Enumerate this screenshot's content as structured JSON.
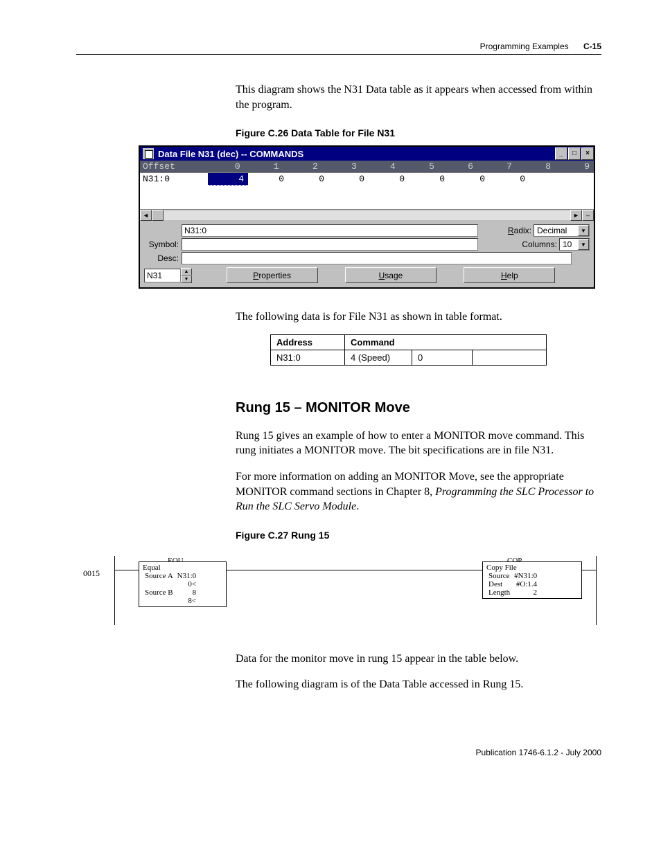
{
  "header": {
    "section": "Programming Examples",
    "pagenum": "C-15"
  },
  "intro": "This diagram shows the N31 Data table as it appears when accessed from within the program.",
  "fig26_caption": "Figure C.26 Data Table for File N31",
  "datafile": {
    "title": "Data File N31 (dec) -- COMMANDS",
    "header_cols": [
      "Offset",
      "0",
      "1",
      "2",
      "3",
      "4",
      "5",
      "6",
      "7",
      "8",
      "9"
    ],
    "row_label": "N31:0",
    "row_vals": [
      "4",
      "0",
      "0",
      "0",
      "0",
      "0",
      "0",
      "0"
    ],
    "address_field": "N31:0",
    "symbol_label": "Symbol:",
    "desc_label": "Desc:",
    "radix_label": "Radix:",
    "radix_value": "Decimal",
    "columns_label": "Columns:",
    "columns_value": "10",
    "file_value": "N31",
    "btn_properties": "Properties",
    "btn_properties_u": "P",
    "btn_usage": "Usage",
    "btn_usage_u": "U",
    "btn_help": "Help",
    "btn_help_u": "H"
  },
  "after_fig26": "The following data is for File N31 as shown in table format.",
  "datatable": {
    "headers": [
      "Address",
      "Command"
    ],
    "row": [
      "N31:0",
      "4 (Speed)",
      "0",
      ""
    ]
  },
  "section_heading": "Rung 15 – MONITOR Move",
  "para1": "Rung 15 gives an example of how to enter a MONITOR move command.  This rung initiates a MONITOR move.  The bit specifications are in file N31.",
  "para2a": "For more information on adding an MONITOR Move, see the appropriate MONITOR command sections in Chapter 8, ",
  "para2b": "Programming the SLC Processor to Run the SLC Servo Module",
  "para2c": ".",
  "fig27_caption": "Figure C.27 Rung 15",
  "ladder": {
    "rung_num": "0015",
    "equ": {
      "title": "EQU",
      "name": "Equal",
      "rows": [
        [
          "Source A",
          "N31:0"
        ],
        [
          "",
          "0<"
        ],
        [
          "Source B",
          "8"
        ],
        [
          "",
          "8<"
        ]
      ]
    },
    "cop": {
      "title": "COP",
      "name": "Copy File",
      "rows": [
        [
          "Source",
          "#N31:0"
        ],
        [
          "Dest",
          "#O:1.4"
        ],
        [
          "Length",
          "2"
        ]
      ]
    }
  },
  "after_ladder1": "Data for the monitor move in rung 15 appear in the table below.",
  "after_ladder2": "The following diagram is of the Data Table accessed in Rung 15.",
  "footer": "Publication 1746-6.1.2 - July 2000"
}
